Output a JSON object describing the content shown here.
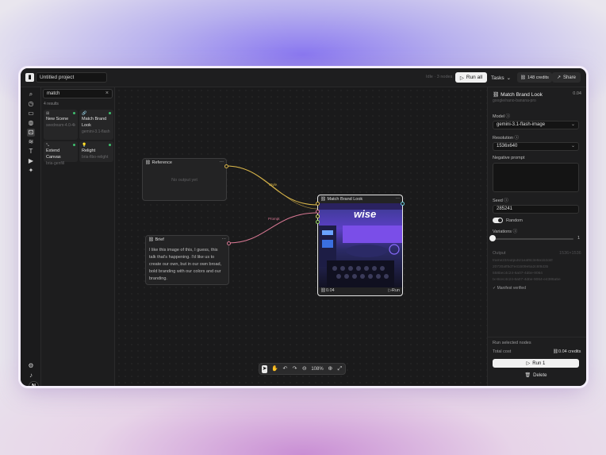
{
  "topbar": {
    "project_name": "Untitled project",
    "status": "Idle · 3 nodes",
    "run_all_label": "Run all",
    "tasks_label": "Tasks",
    "credits_label": "148 credits",
    "share_label": "Share"
  },
  "rail": {
    "icons": [
      "search-icon",
      "history-icon",
      "folder-icon",
      "palette-icon",
      "nodes-icon",
      "layers-icon",
      "text-icon",
      "video-icon",
      "magic-icon"
    ],
    "avatar_letter": "N"
  },
  "node_search": {
    "query": "match",
    "results_label": "4 results",
    "cards": [
      {
        "icon": "⊞",
        "name": "New Scene",
        "sub": "seedream-4.0-4k"
      },
      {
        "icon": "🔗",
        "name": "Match Brand Look",
        "sub": "gemini-3.1-flash"
      },
      {
        "icon": "⤡",
        "name": "Extend Canvas",
        "sub": "bria-genfill"
      },
      {
        "icon": "💡",
        "name": "Relight",
        "sub": "bria-fibo-relight"
      }
    ]
  },
  "canvas": {
    "reference_node": {
      "title": "Reference",
      "empty_text": "No output yet"
    },
    "brief_node": {
      "title": "Brief",
      "text": "I like this image of this, I guess, this talk that's happening. I'd like us to create our own, but in our own broad, bold branding with our colors and our branding."
    },
    "match_node": {
      "title": "Match Brand Look",
      "cost": "0.04",
      "run_label": "Run",
      "image_caption": "wise"
    },
    "edges": {
      "style_label": "Style",
      "prompt_label": "Prompt"
    },
    "zoom_label": "108%"
  },
  "inspector": {
    "title": "Match Brand Look",
    "cost": "0.04",
    "model_id": "google/nano-banana-pro",
    "model_label": "Model",
    "model_value": "gemini-3.1-flash-image",
    "resolution_label": "Resolution",
    "resolution_value": "1536x640",
    "negative_prompt_label": "Negative prompt",
    "seed_label": "Seed",
    "seed_value": "285241",
    "random_label": "Random",
    "variations_label": "Variations",
    "variations_value": "1",
    "output_label": "Output",
    "output_size": "1536×1536",
    "output_lines": [
      "frame23/outputs/1eaf8c3e9a1b2d4f",
      "20730aff5d7e41b09e5a2c6f8d3b",
      "558bec4c24-6a07-4dbe-9064",
      "tx-8cec4c24-6a07-4dbe-9064-e4386a5e"
    ],
    "manifest_label": "Manifest verified",
    "run_selected_label": "Run selected nodes",
    "total_cost_label": "Total cost",
    "total_cost_value": "0.04 credits",
    "run_button_label": "Run 1",
    "delete_label": "Delete"
  }
}
